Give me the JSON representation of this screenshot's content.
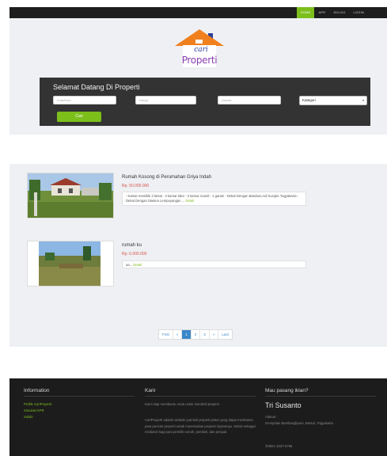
{
  "nav": {
    "items": [
      {
        "label": "HOME",
        "active": true
      },
      {
        "label": "APR",
        "active": false
      },
      {
        "label": "SOLGO",
        "active": false
      },
      {
        "label": "LOGIN",
        "active": false
      }
    ]
  },
  "logo": {
    "line1": "cari",
    "line2": "Properti"
  },
  "search": {
    "title": "Selamat Datang Di Properti",
    "kota_placeholder": "Kota/Kota",
    "harga_placeholder": "Harga",
    "alamat_placeholder": "Alamat",
    "kategori_value": "Kategori",
    "button": "Cari"
  },
  "listings": [
    {
      "title": "Rumah Kosong di Perumahan Griya Indah",
      "price": "Rp. 50.000.000",
      "desc": "- Kamar memiliki 3 lantai - 2 kamar tidur - 2 kamar mandi - 1 garasi - Dekat Dengan Bandara Adi Sucipto Yogyakarta - Dekat Dengan Stasiun Lempuyangan ...",
      "detail": "Detail"
    },
    {
      "title": "rumah ku",
      "price": "Rp. 6.000.000",
      "desc": "aa...",
      "detail": "Detail"
    }
  ],
  "pagination": [
    "First",
    "«",
    "1",
    "2",
    "3",
    "»",
    "Last"
  ],
  "pagination_active": "1",
  "footer": {
    "info": {
      "heading": "Information",
      "links": [
        "Profile CariProperti",
        "Simulasi KPR",
        "Solido"
      ]
    },
    "karir": {
      "heading": "Karir",
      "line1": "Kami siap membantu Anda untuk membeli properti.",
      "para": "CariProperti adalah website jual-beli properti pintar yang dapat membantu para pencari properti untuk menemukan properti impiannya. Selain sebagai mediator bagi para pemilik rumah, pembeli, dan penjual."
    },
    "contact": {
      "heading": "Mau pasang iklan?",
      "name": "Tri Susanto",
      "address_label": "Alamat :",
      "address": "Gempolan Bambanglipuro, Bantul, Yogyakarta",
      "phone": "0821-3437-5796"
    }
  },
  "colors": {
    "accent": "#7cbf1b",
    "price": "#d9534f",
    "link": "#3a87c9",
    "dark": "#333333"
  }
}
